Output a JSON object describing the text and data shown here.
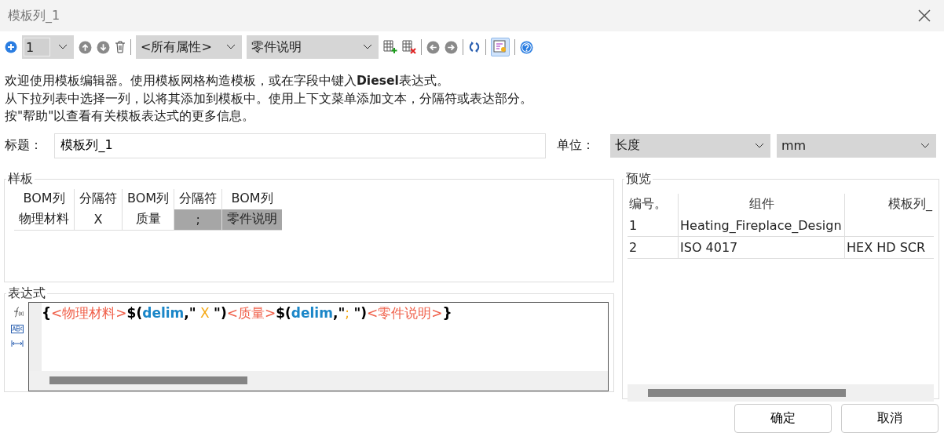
{
  "window": {
    "title": "模板列_1"
  },
  "toolbar": {
    "row_number": "1",
    "attribute_filter": "<所有属性>",
    "property": "零件说明",
    "preview_toggle_pressed": true
  },
  "intro": [
    "欢迎使用模板编辑器。使用模板网格构造模板，或在字段中键入**Diesel**表达式。",
    "从下拉列表中选择一列，以将其添加到模板中。使用上下文菜单添加文本，分隔符或表达部分。",
    "按\"帮助\"以查看有关模板表达式的更多信息。"
  ],
  "title_field": {
    "label": "标题：",
    "value": "模板列_1"
  },
  "unit": {
    "label": "单位：",
    "quantity": "长度",
    "unit": "mm"
  },
  "template": {
    "title": "样板",
    "columns": [
      {
        "header": "BOM列",
        "value": "物理材料",
        "selected": false
      },
      {
        "header": "分隔符",
        "value": "X",
        "selected": false
      },
      {
        "header": "BOM列",
        "value": "质量",
        "selected": false
      },
      {
        "header": "分隔符",
        "value": ";",
        "selected": true
      },
      {
        "header": "BOM列",
        "value": "零件说明",
        "selected": true
      }
    ]
  },
  "expression": {
    "title": "表达式",
    "tokens": [
      {
        "kind": "punct",
        "text": "{"
      },
      {
        "kind": "field",
        "text": "<物理材料>"
      },
      {
        "kind": "punct",
        "text": "$("
      },
      {
        "kind": "keyword",
        "text": "delim"
      },
      {
        "kind": "punct",
        "text": ",\""
      },
      {
        "kind": "string",
        "text": " X "
      },
      {
        "kind": "punct",
        "text": "\")"
      },
      {
        "kind": "field",
        "text": "<质量>"
      },
      {
        "kind": "punct",
        "text": "$("
      },
      {
        "kind": "keyword",
        "text": "delim"
      },
      {
        "kind": "punct",
        "text": ",\""
      },
      {
        "kind": "string",
        "text": "; "
      },
      {
        "kind": "punct",
        "text": "\")"
      },
      {
        "kind": "field",
        "text": "<零件说明>"
      },
      {
        "kind": "punct",
        "text": "}"
      }
    ]
  },
  "preview": {
    "title": "预览",
    "columns": [
      "编号。",
      "组件",
      "模板列_"
    ],
    "rows": [
      [
        "1",
        "Heating_Fireplace_Design",
        ""
      ],
      [
        "2",
        "ISO 4017",
        "HEX HD SCR"
      ]
    ]
  },
  "buttons": [
    "确定",
    "取消"
  ]
}
